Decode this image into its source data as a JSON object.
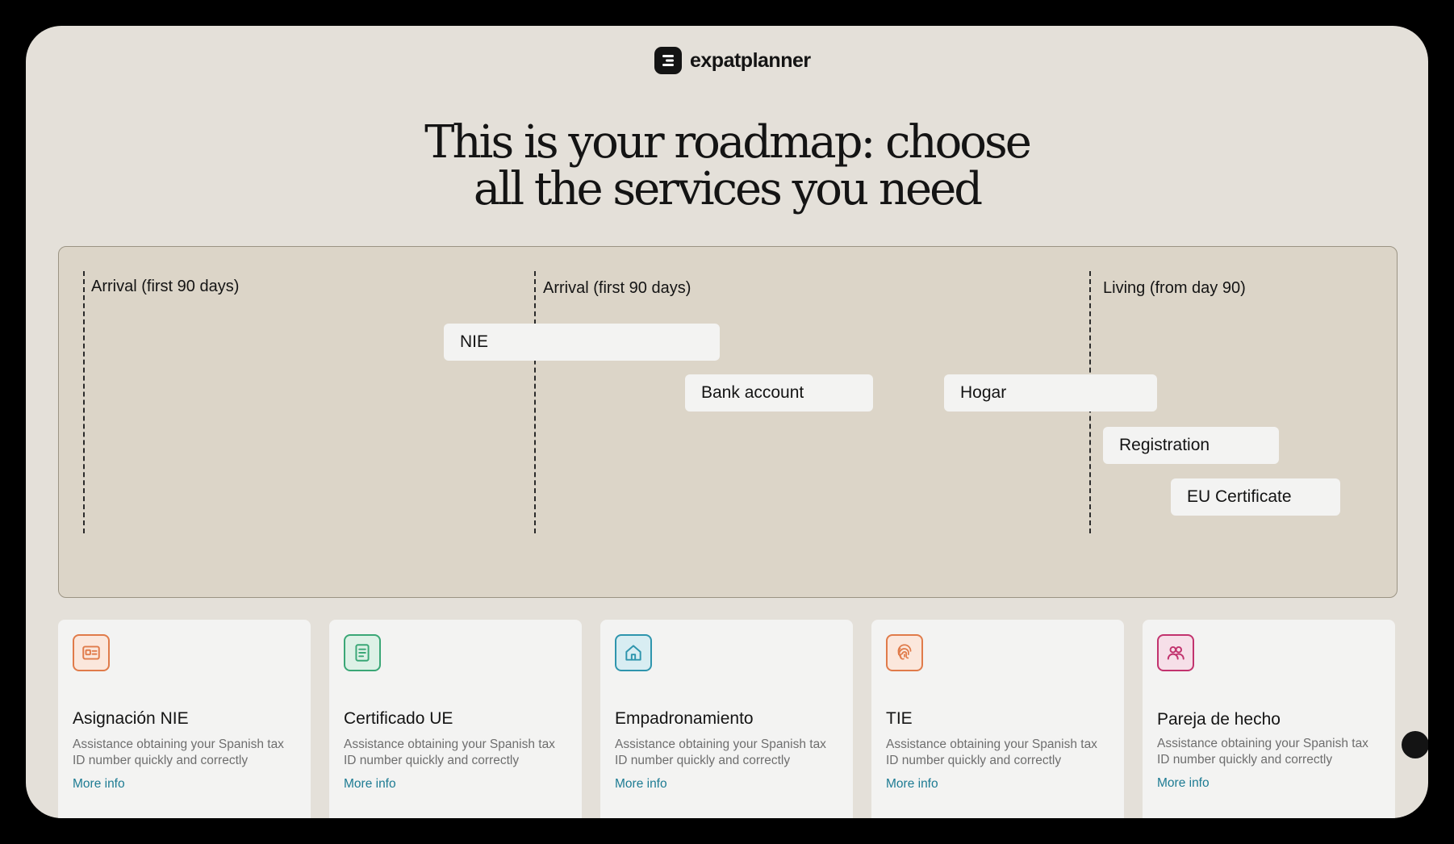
{
  "brand": {
    "name": "expatplanner"
  },
  "hero": {
    "line1": "This is your roadmap: choose",
    "line2": "all the services you need"
  },
  "roadmap": {
    "phases": [
      {
        "label": "Arrival (first 90 days)"
      },
      {
        "label": "Arrival (first 90 days)"
      },
      {
        "label": "Living (from day 90)"
      }
    ],
    "tasks": [
      {
        "label": "NIE"
      },
      {
        "label": "Bank account"
      },
      {
        "label": "Hogar"
      },
      {
        "label": "Registration"
      },
      {
        "label": "EU Certificate"
      }
    ]
  },
  "services": [
    {
      "title": "Asignación NIE",
      "description": "Assistance obtaining your Spanish tax ID number quickly and correctly",
      "link": "More info",
      "icon": "id-card-icon",
      "color": "#e07b4a"
    },
    {
      "title": "Certificado UE",
      "description": "Assistance obtaining your Spanish tax ID number quickly and correctly",
      "link": "More info",
      "icon": "document-icon",
      "color": "#3aa776"
    },
    {
      "title": "Empadronamiento",
      "description": "Assistance obtaining your Spanish tax ID number quickly and correctly",
      "link": "More info",
      "icon": "house-icon",
      "color": "#2e95ad"
    },
    {
      "title": "TIE",
      "description": "Assistance obtaining your Spanish tax ID number quickly and correctly",
      "link": "More info",
      "icon": "fingerprint-icon",
      "color": "#e07b4a"
    },
    {
      "title": "Pareja de hecho",
      "description": "Assistance obtaining your Spanish tax ID number quickly and correctly",
      "link": "More info",
      "icon": "couple-icon",
      "color": "#c2336e"
    }
  ]
}
